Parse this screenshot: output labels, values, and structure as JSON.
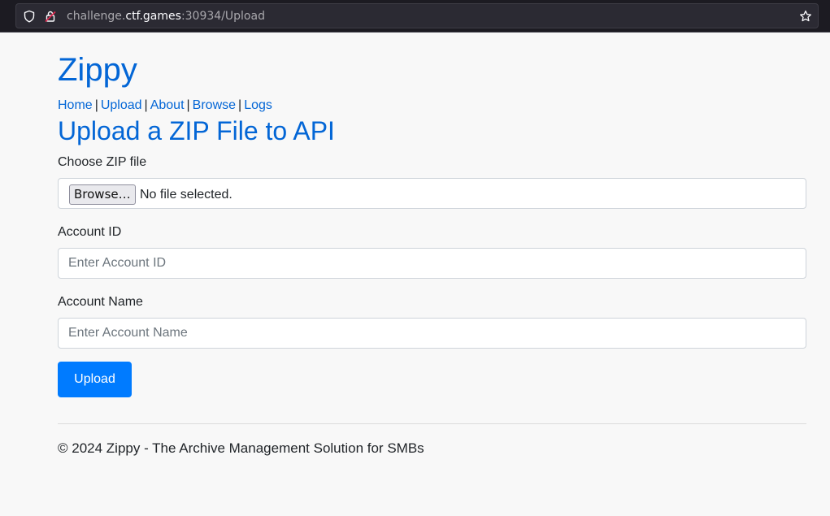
{
  "browser": {
    "url_prefix": "challenge.",
    "url_host": "ctf.games",
    "url_suffix": ":30934/Upload"
  },
  "header": {
    "brand": "Zippy",
    "nav": [
      {
        "label": "Home"
      },
      {
        "label": "Upload"
      },
      {
        "label": "About"
      },
      {
        "label": "Browse"
      },
      {
        "label": "Logs"
      }
    ],
    "nav_separator": "|"
  },
  "main": {
    "title": "Upload a ZIP File to API",
    "zip_file": {
      "label": "Choose ZIP file",
      "button_label": "Browse…",
      "status": "No file selected."
    },
    "account_id": {
      "label": "Account ID",
      "placeholder": "Enter Account ID",
      "value": ""
    },
    "account_name": {
      "label": "Account Name",
      "placeholder": "Enter Account Name",
      "value": ""
    },
    "submit_label": "Upload"
  },
  "footer": {
    "text": "© 2024 Zippy - The Archive Management Solution for SMBs"
  },
  "colors": {
    "link": "#0366d6",
    "primary_button": "#007bff",
    "page_background": "#f8f8f8",
    "browser_toolbar": "#1c1b22"
  },
  "icons": {
    "site_info": "shield-icon",
    "insecure": "lock-warning-icon",
    "bookmark": "star-icon"
  }
}
